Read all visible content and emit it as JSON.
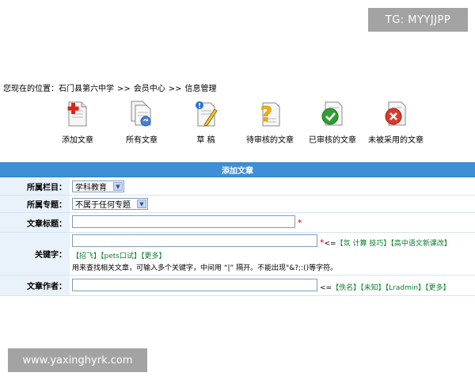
{
  "watermarks": {
    "top": "TG: MYYJJPP",
    "bottom": "www.yaxinghyrk.com"
  },
  "breadcrumb": {
    "prefix": "您现在的位置：",
    "items": [
      "石门县第六中学",
      "会员中心",
      "信息管理"
    ],
    "separator": ">>"
  },
  "toolbar": {
    "items": [
      {
        "label": "添加文章",
        "icon": "add-article-icon"
      },
      {
        "label": "所有文章",
        "icon": "all-articles-icon"
      },
      {
        "label": "草  稿",
        "icon": "draft-icon"
      },
      {
        "label": "待审核的文章",
        "icon": "pending-review-icon"
      },
      {
        "label": "已审核的文章",
        "icon": "approved-icon"
      },
      {
        "label": "未被采用的文章",
        "icon": "rejected-icon"
      }
    ]
  },
  "form": {
    "header": "添加文章",
    "column_label": "所属栏目：",
    "column_value": "学科教育",
    "topic_label": "所属专题：",
    "topic_value": "不属于任何专题",
    "title_label": "文章标题：",
    "title_value": "",
    "required_mark": "*",
    "keyword_label": "关键字：",
    "keyword_value": "",
    "keyword_required": "*",
    "keyword_prefix": "<=",
    "keyword_suggest_1": "【氛 计算 技巧】",
    "keyword_suggest_2": "【高中语文新课改】",
    "keyword_suggest_3": "【招飞】",
    "keyword_suggest_4": "【pets口试】",
    "keyword_suggest_5": "【更多】",
    "keyword_hint": "用来查找相关文章，可输入多个关键字，中间用 “|” 隔开。不能出现\"&?;:()等字符。",
    "author_label": "文章作者：",
    "author_value": "",
    "author_prefix": "<=",
    "author_suggest_1": "【佚名】",
    "author_suggest_2": "【未知】",
    "author_suggest_3": "【Lradmin】",
    "author_suggest_4": "【更多】"
  }
}
